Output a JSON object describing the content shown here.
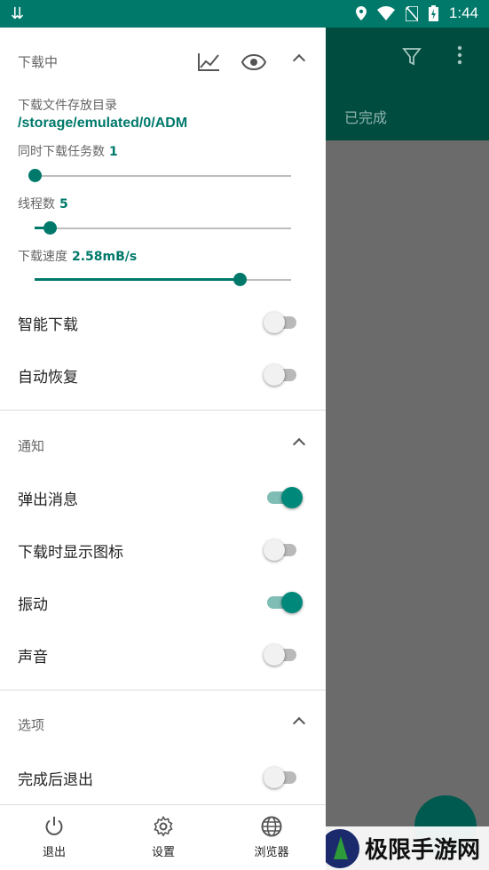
{
  "status_bar": {
    "time": "1:44"
  },
  "background_app": {
    "tab_label": "已完成"
  },
  "watermark": {
    "text": "极限手游网"
  },
  "drawer": {
    "downloading": {
      "title": "下载中",
      "folder_label": "下载文件存放目录",
      "folder_path": "/storage/emulated/0/ADM",
      "concurrent_label": "同时下载任务数",
      "concurrent_value": "1",
      "concurrent_level": 0.0,
      "threads_label": "线程数",
      "threads_value": "5",
      "threads_level": 0.06,
      "speed_label": "下载速度",
      "speed_value": "2.58mB/s",
      "speed_level": 0.8,
      "smart_download_label": "智能下载",
      "smart_download_on": false,
      "auto_resume_label": "自动恢复",
      "auto_resume_on": false
    },
    "notifications": {
      "title": "通知",
      "popup_label": "弹出消息",
      "popup_on": true,
      "show_icon_label": "下载时显示图标",
      "show_icon_on": false,
      "vibrate_label": "振动",
      "vibrate_on": true,
      "sound_label": "声音",
      "sound_on": false
    },
    "options": {
      "title": "选项",
      "exit_after_label": "完成后退出",
      "exit_after_on": false
    },
    "bottom_nav": {
      "exit_label": "退出",
      "settings_label": "设置",
      "browser_label": "浏览器"
    }
  },
  "colors": {
    "accent": "#00796b",
    "status_bar": "#00796b",
    "app_bar": "#004d40"
  }
}
